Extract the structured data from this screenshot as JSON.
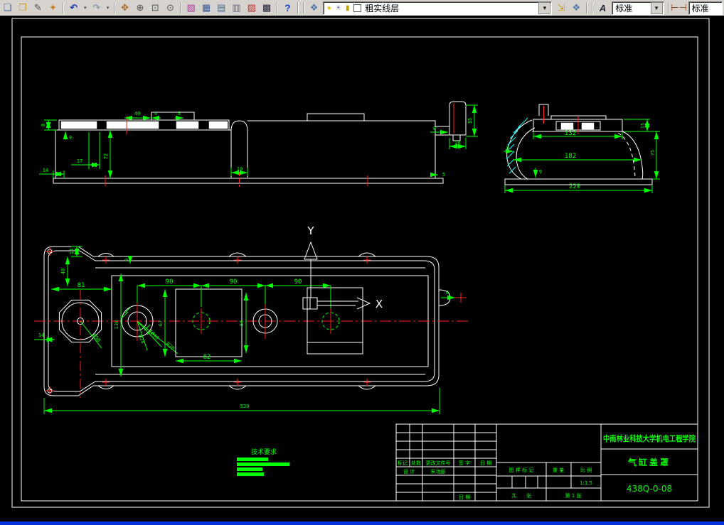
{
  "toolbar": {
    "layer_combo_value": "粗实线层",
    "text_style_value": "标准",
    "dim_style_value": "标准",
    "icons": [
      "copy",
      "open-block",
      "pencil-edit",
      "match-properties",
      "undo",
      "undo-dropdown",
      "redo",
      "redo-dropdown",
      "pan-realtime",
      "zoom-realtime",
      "zoom-window",
      "zoom-previous",
      "properties",
      "design-center",
      "tool-palettes",
      "sheet-set-manager",
      "markup-set-manager",
      "quick-calc",
      "help",
      "layer-properties-manager",
      "layer-bulb",
      "layer-freeze",
      "layer-lock",
      "layer-color-swatch",
      "chevron-down",
      "make-object-layer-current",
      "layer-previous",
      "text-style-manager",
      "dimension-style-manager"
    ]
  },
  "drawing": {
    "ucs": {
      "x": "X",
      "y": "Y"
    },
    "notes_title": "技术要求",
    "dims": {
      "front": {
        "f1": "8",
        "f2": "9",
        "f3": "40",
        "f4": "4",
        "f5": "5",
        "f6": "17",
        "f7": "72",
        "f8": "14",
        "f9": "10",
        "f10": "8",
        "f11": "35",
        "f12": "18",
        "f13": "5"
      },
      "side": {
        "s1": "132",
        "s2": "182",
        "s3": "220",
        "s4": "75",
        "s5": "15",
        "s6": "8",
        "s7": "9"
      },
      "plan": {
        "p1": "14",
        "p2": "40",
        "p3": "9",
        "p4": "81",
        "p5": "90",
        "p6": "90",
        "p7": "90",
        "p8": "138",
        "p9": "67",
        "p10": "84",
        "p11": "82",
        "p12": "14",
        "p13": "530",
        "p14": "Ø24",
        "p15": "Ø40",
        "p16": "R20",
        "p17": "Ø50",
        "p18": "8"
      }
    }
  },
  "title_block": {
    "college": "中南林业科技大学机电工程学院",
    "part_name": "气缸盖罩",
    "drawing_no": "438Q-0-08",
    "scale_value": "1:1.5",
    "labels": {
      "mark": "标记",
      "count": "处数",
      "change_doc": "更改文件号",
      "sign": "签 字",
      "date": "日 期",
      "design": "设 计",
      "designer": "宋功丽",
      "date2": "日 期",
      "stamp": "图 样 标 记",
      "weight": "重 量",
      "scale": "比 例",
      "sheets_total": "共　　张",
      "sheet_no": "第 1 张"
    }
  }
}
